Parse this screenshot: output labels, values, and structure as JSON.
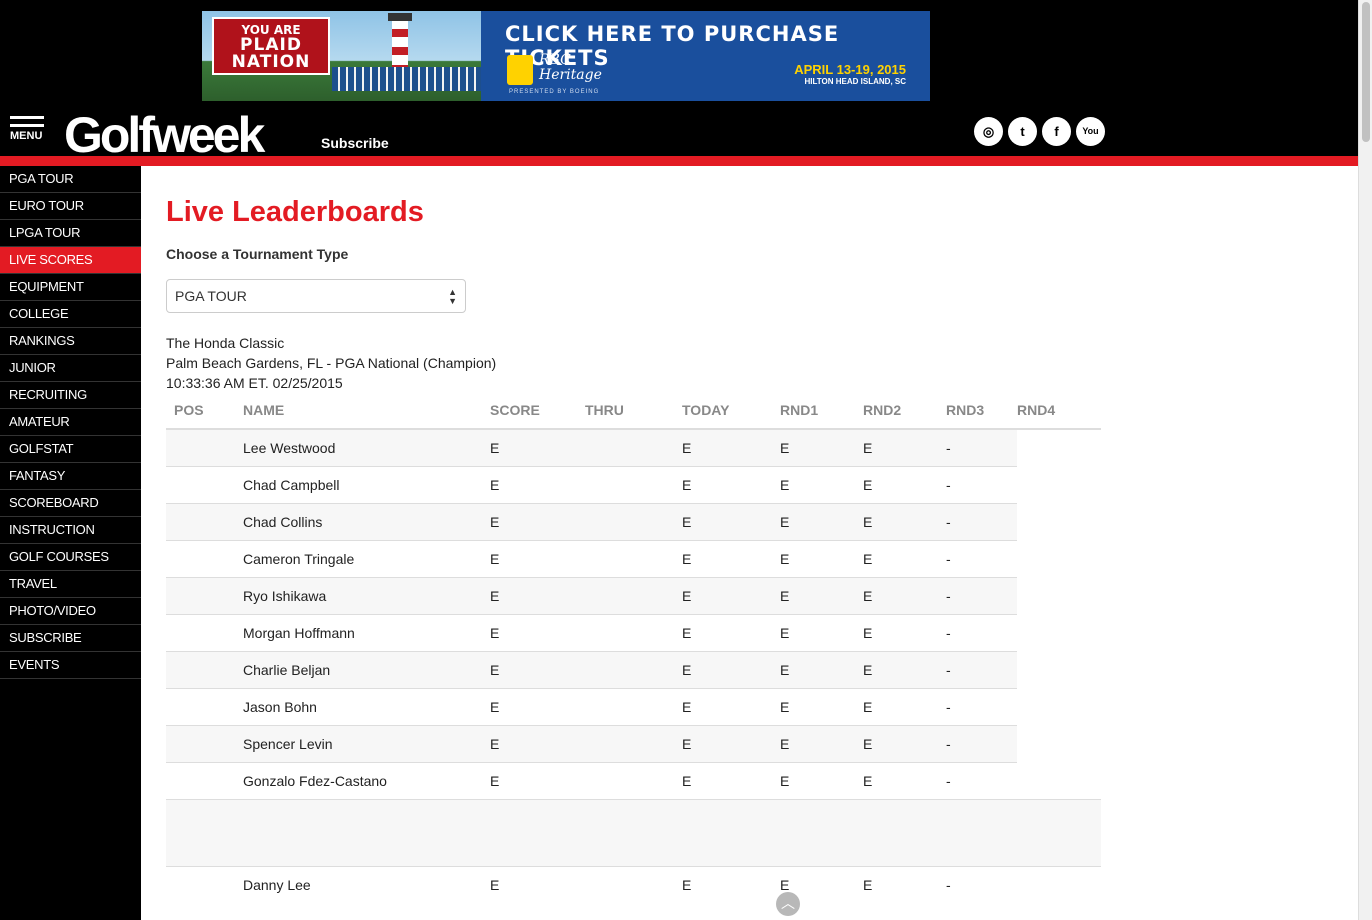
{
  "ad": {
    "tagline_top": "YOU ARE",
    "tagline_main": "PLAID NATION",
    "cta": "CLICK HERE TO PURCHASE TICKETS",
    "brand_line1": "RBC",
    "brand_line2": "Heritage",
    "presented": "PRESENTED BY BOEING",
    "dates": "APRIL 13-19, 2015",
    "location": "HILTON HEAD ISLAND, SC"
  },
  "header": {
    "menu_label": "MENU",
    "logo": "Golfweek",
    "subscribe": "Subscribe",
    "social": [
      "instagram-icon",
      "twitter-icon",
      "facebook-icon",
      "youtube-icon"
    ],
    "social_glyphs": [
      "◎",
      "t",
      "f",
      "You"
    ]
  },
  "sidebar": {
    "items": [
      {
        "label": "PGA TOUR"
      },
      {
        "label": "EURO TOUR"
      },
      {
        "label": "LPGA TOUR"
      },
      {
        "label": "LIVE SCORES",
        "active": true
      },
      {
        "label": "EQUIPMENT"
      },
      {
        "label": "COLLEGE"
      },
      {
        "label": "RANKINGS"
      },
      {
        "label": "JUNIOR"
      },
      {
        "label": "RECRUITING"
      },
      {
        "label": "AMATEUR"
      },
      {
        "label": "GOLFSTAT"
      },
      {
        "label": "FANTASY"
      },
      {
        "label": "SCOREBOARD"
      },
      {
        "label": "INSTRUCTION"
      },
      {
        "label": "GOLF COURSES"
      },
      {
        "label": "TRAVEL"
      },
      {
        "label": "PHOTO/VIDEO"
      },
      {
        "label": "SUBSCRIBE"
      },
      {
        "label": "EVENTS"
      }
    ]
  },
  "main": {
    "title": "Live Leaderboards",
    "choose_label": "Choose a Tournament Type",
    "tournament_type": "PGA TOUR",
    "tournament_name": "The Honda Classic",
    "tournament_location": "Palm Beach Gardens, FL - PGA National (Champion)",
    "tournament_time": "10:33:36 AM ET. 02/25/2015",
    "columns": [
      "POS",
      "NAME",
      "SCORE",
      "THRU",
      "TODAY",
      "RND1",
      "RND2",
      "RND3",
      "RND4"
    ],
    "rows": [
      {
        "pos": "",
        "name": "Lee Westwood",
        "score": "E",
        "thru": "",
        "today": "E",
        "rnd1": "E",
        "rnd2": "E",
        "rnd3": "-"
      },
      {
        "pos": "",
        "name": "Chad Campbell",
        "score": "E",
        "thru": "",
        "today": "E",
        "rnd1": "E",
        "rnd2": "E",
        "rnd3": "-"
      },
      {
        "pos": "",
        "name": "Chad Collins",
        "score": "E",
        "thru": "",
        "today": "E",
        "rnd1": "E",
        "rnd2": "E",
        "rnd3": "-"
      },
      {
        "pos": "",
        "name": "Cameron Tringale",
        "score": "E",
        "thru": "",
        "today": "E",
        "rnd1": "E",
        "rnd2": "E",
        "rnd3": "-"
      },
      {
        "pos": "",
        "name": "Ryo Ishikawa",
        "score": "E",
        "thru": "",
        "today": "E",
        "rnd1": "E",
        "rnd2": "E",
        "rnd3": "-"
      },
      {
        "pos": "",
        "name": "Morgan Hoffmann",
        "score": "E",
        "thru": "",
        "today": "E",
        "rnd1": "E",
        "rnd2": "E",
        "rnd3": "-"
      },
      {
        "pos": "",
        "name": "Charlie Beljan",
        "score": "E",
        "thru": "",
        "today": "E",
        "rnd1": "E",
        "rnd2": "E",
        "rnd3": "-"
      },
      {
        "pos": "",
        "name": "Jason Bohn",
        "score": "E",
        "thru": "",
        "today": "E",
        "rnd1": "E",
        "rnd2": "E",
        "rnd3": "-"
      },
      {
        "pos": "",
        "name": "Spencer Levin",
        "score": "E",
        "thru": "",
        "today": "E",
        "rnd1": "E",
        "rnd2": "E",
        "rnd3": "-"
      },
      {
        "pos": "",
        "name": "Gonzalo Fdez-Castano",
        "score": "E",
        "thru": "",
        "today": "E",
        "rnd1": "E",
        "rnd2": "E",
        "rnd3": "-"
      }
    ],
    "rows_after": [
      {
        "pos": "",
        "name": "Danny Lee",
        "score": "E",
        "thru": "",
        "today": "E",
        "rnd1": "E",
        "rnd2": "E",
        "rnd3": "-"
      }
    ]
  }
}
